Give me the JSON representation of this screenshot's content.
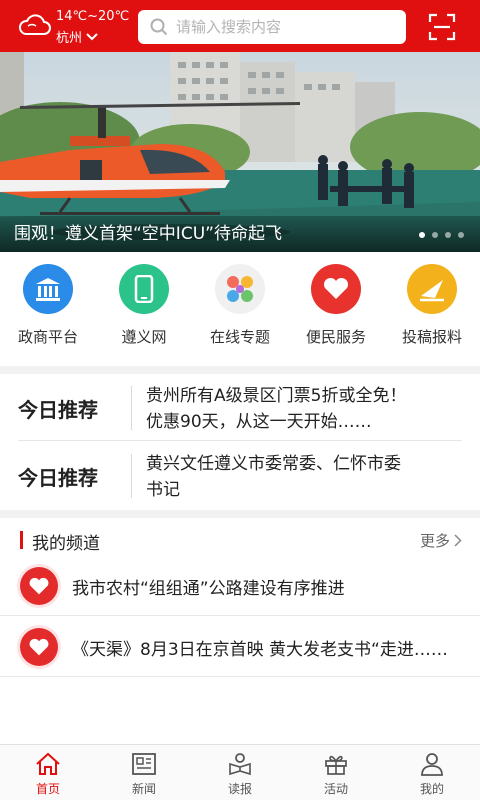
{
  "header": {
    "temperature": "14℃~20℃",
    "city": "杭州",
    "search_placeholder": "请输入搜索内容"
  },
  "banner": {
    "caption": "围观！遵义首架“空中ICU”待命起飞",
    "dots_total": 4,
    "active_dot": 1
  },
  "quick_links": [
    {
      "label": "政商平台",
      "icon": "government-building-icon",
      "color": "#2b8be8"
    },
    {
      "label": "遵义网",
      "icon": "phone-icon",
      "color": "#2cc38a"
    },
    {
      "label": "在线专题",
      "icon": "petals-icon",
      "color": "#f0f0f0"
    },
    {
      "label": "便民服务",
      "icon": "heart-icon",
      "color": "#e8322e"
    },
    {
      "label": "投稿报料",
      "icon": "paper-plane-icon",
      "color": "#f3b21c"
    }
  ],
  "recommend": [
    {
      "tag": "今日推荐",
      "line1": "贵州所有A级景区门票5折或全免！",
      "line2": "优惠90天，从这一天开始……"
    },
    {
      "tag": "今日推荐",
      "line1": "黄兴文任遵义市委常委、仁怀市委",
      "line2": "书记"
    }
  ],
  "channel": {
    "title": "我的频道",
    "more": "更多",
    "items": [
      {
        "title": "我市农村“组组通”公路建设有序推进"
      },
      {
        "title": "《天渠》8月3日在京首映 黄大发老支书“走进……"
      }
    ]
  },
  "tabs": [
    {
      "label": "首页",
      "icon": "home-icon",
      "active": true
    },
    {
      "label": "新闻",
      "icon": "newspaper-icon",
      "active": false
    },
    {
      "label": "读报",
      "icon": "reader-icon",
      "active": false
    },
    {
      "label": "活动",
      "icon": "gift-icon",
      "active": false
    },
    {
      "label": "我的",
      "icon": "user-icon",
      "active": false
    }
  ],
  "colors": {
    "brand_red": "#e01010"
  }
}
